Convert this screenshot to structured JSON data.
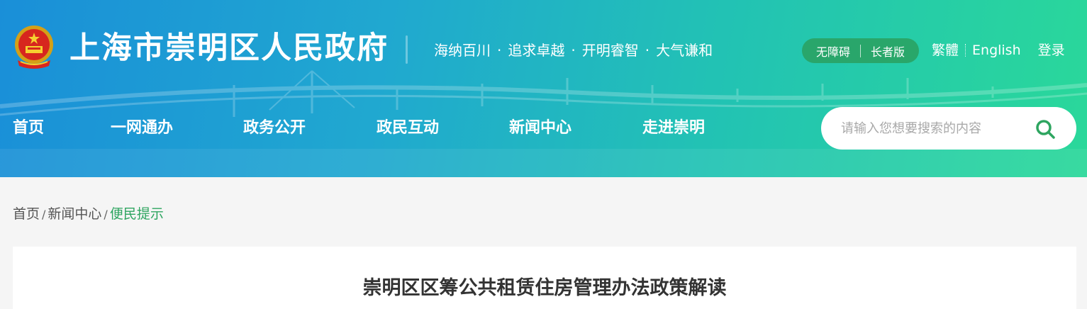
{
  "header": {
    "site_title": "上海市崇明区人民政府",
    "slogan": [
      "海纳百川",
      "追求卓越",
      "开明睿智",
      "大气谦和"
    ],
    "slogan_separator": "·",
    "accessibility": "无障碍",
    "elder_mode": "长者版",
    "traditional": "繁體",
    "english": "English",
    "login": "登录",
    "emblem_icon": "national-emblem-icon",
    "colors": {
      "gradient_start": "#1a8fd8",
      "gradient_end": "#2ad89a",
      "pill": "#2aa05f"
    }
  },
  "nav": {
    "items": [
      {
        "label": "首页"
      },
      {
        "label": "一网通办"
      },
      {
        "label": "政务公开"
      },
      {
        "label": "政民互动"
      },
      {
        "label": "新闻中心"
      },
      {
        "label": "走进崇明"
      }
    ]
  },
  "search": {
    "placeholder": "请输入您想要搜索的内容",
    "icon": "search-icon",
    "icon_color": "#2ea560"
  },
  "breadcrumb": {
    "items": [
      "首页",
      "新闻中心"
    ],
    "separator": "/",
    "current": "便民提示",
    "current_color": "#2ea560"
  },
  "article": {
    "title": "崇明区区筹公共租赁住房管理办法政策解读"
  }
}
